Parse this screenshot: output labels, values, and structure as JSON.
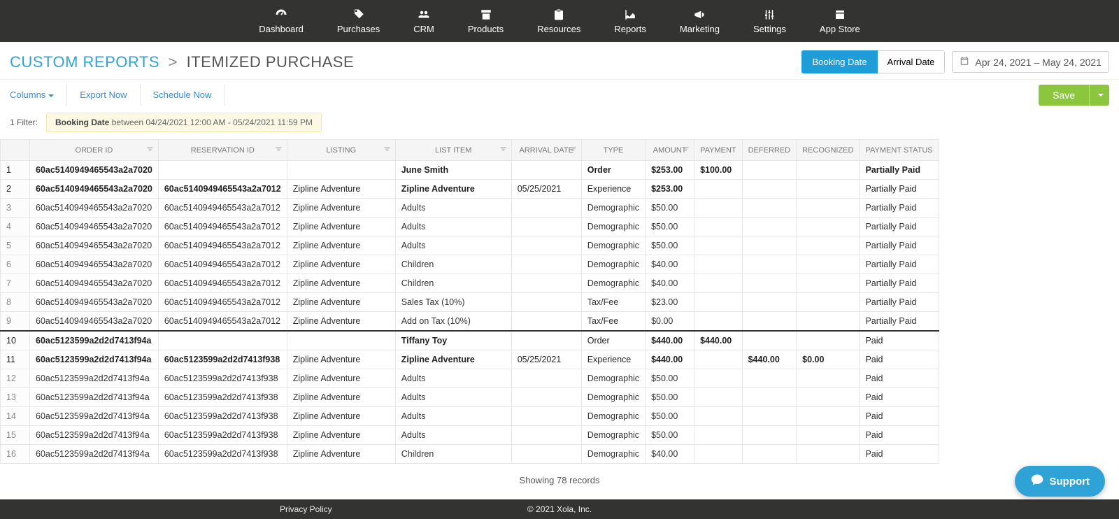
{
  "nav": {
    "items": [
      {
        "label": "Dashboard",
        "icon": "dashboard"
      },
      {
        "label": "Purchases",
        "icon": "tag"
      },
      {
        "label": "CRM",
        "icon": "people"
      },
      {
        "label": "Products",
        "icon": "box"
      },
      {
        "label": "Resources",
        "icon": "clipboard"
      },
      {
        "label": "Reports",
        "icon": "chart"
      },
      {
        "label": "Marketing",
        "icon": "megaphone"
      },
      {
        "label": "Settings",
        "icon": "sliders"
      },
      {
        "label": "App Store",
        "icon": "app"
      }
    ]
  },
  "breadcrumb": {
    "root": "CUSTOM REPORTS",
    "sep": ">",
    "page": "ITEMIZED PURCHASE"
  },
  "dateToggle": {
    "booking": "Booking Date",
    "arrival": "Arrival Date",
    "active": "booking"
  },
  "dateRange": "Apr 24, 2021 – May 24, 2021",
  "toolbar": {
    "columns": "Columns",
    "export": "Export Now",
    "schedule": "Schedule Now",
    "save": "Save"
  },
  "filter": {
    "count_label": "1 Filter:",
    "field": "Booking Date",
    "text": "between 04/24/2021 12:00 AM - 05/24/2021 11:59 PM"
  },
  "columns": [
    "ORDER ID",
    "RESERVATION ID",
    "LISTING",
    "LIST ITEM",
    "ARRIVAL DATE",
    "TYPE",
    "AMOUNT",
    "PAYMENT",
    "DEFERRED",
    "RECOGNIZED",
    "PAYMENT STATUS"
  ],
  "filterable_cols": [
    0,
    1,
    2,
    3,
    4,
    6
  ],
  "rows": [
    {
      "n": 1,
      "bold": true,
      "cells": [
        "60ac5140949465543a2a7020",
        "",
        "",
        "June Smith",
        "",
        "Order",
        "$253.00",
        "$100.00",
        "",
        "",
        "Partially Paid"
      ]
    },
    {
      "n": 2,
      "bold": true,
      "cells": [
        "60ac5140949465543a2a7020",
        "60ac5140949465543a2a7012",
        "Zipline Adventure",
        "Zipline Adventure",
        "05/25/2021",
        "Experience",
        "$253.00",
        "",
        "",
        "",
        "Partially Paid"
      ],
      "light_cols": [
        2,
        4,
        5,
        10
      ]
    },
    {
      "n": 3,
      "bold": false,
      "cells": [
        "60ac5140949465543a2a7020",
        "60ac5140949465543a2a7012",
        "Zipline Adventure",
        "Adults",
        "",
        "Demographic",
        "$50.00",
        "",
        "",
        "",
        "Partially Paid"
      ]
    },
    {
      "n": 4,
      "bold": false,
      "cells": [
        "60ac5140949465543a2a7020",
        "60ac5140949465543a2a7012",
        "Zipline Adventure",
        "Adults",
        "",
        "Demographic",
        "$50.00",
        "",
        "",
        "",
        "Partially Paid"
      ]
    },
    {
      "n": 5,
      "bold": false,
      "cells": [
        "60ac5140949465543a2a7020",
        "60ac5140949465543a2a7012",
        "Zipline Adventure",
        "Adults",
        "",
        "Demographic",
        "$50.00",
        "",
        "",
        "",
        "Partially Paid"
      ]
    },
    {
      "n": 6,
      "bold": false,
      "cells": [
        "60ac5140949465543a2a7020",
        "60ac5140949465543a2a7012",
        "Zipline Adventure",
        "Children",
        "",
        "Demographic",
        "$40.00",
        "",
        "",
        "",
        "Partially Paid"
      ]
    },
    {
      "n": 7,
      "bold": false,
      "cells": [
        "60ac5140949465543a2a7020",
        "60ac5140949465543a2a7012",
        "Zipline Adventure",
        "Children",
        "",
        "Demographic",
        "$40.00",
        "",
        "",
        "",
        "Partially Paid"
      ]
    },
    {
      "n": 8,
      "bold": false,
      "cells": [
        "60ac5140949465543a2a7020",
        "60ac5140949465543a2a7012",
        "Zipline Adventure",
        "Sales Tax (10%)",
        "",
        "Tax/Fee",
        "$23.00",
        "",
        "",
        "",
        "Partially Paid"
      ]
    },
    {
      "n": 9,
      "bold": false,
      "cells": [
        "60ac5140949465543a2a7020",
        "60ac5140949465543a2a7012",
        "Zipline Adventure",
        "Add on Tax (10%)",
        "",
        "Tax/Fee",
        "$0.00",
        "",
        "",
        "",
        "Partially Paid"
      ]
    },
    {
      "n": 10,
      "bold": true,
      "dark": true,
      "cells": [
        "60ac5123599a2d2d7413f94a",
        "",
        "",
        "Tiffany Toy",
        "",
        "Order",
        "$440.00",
        "$440.00",
        "",
        "",
        "Paid"
      ],
      "light_cols": [
        5,
        10
      ]
    },
    {
      "n": 11,
      "bold": true,
      "cells": [
        "60ac5123599a2d2d7413f94a",
        "60ac5123599a2d2d7413f938",
        "Zipline Adventure",
        "Zipline Adventure",
        "05/25/2021",
        "Experience",
        "$440.00",
        "",
        "$440.00",
        "$0.00",
        "Paid"
      ],
      "light_cols": [
        2,
        4,
        5,
        10
      ]
    },
    {
      "n": 12,
      "bold": false,
      "cells": [
        "60ac5123599a2d2d7413f94a",
        "60ac5123599a2d2d7413f938",
        "Zipline Adventure",
        "Adults",
        "",
        "Demographic",
        "$50.00",
        "",
        "",
        "",
        "Paid"
      ]
    },
    {
      "n": 13,
      "bold": false,
      "cells": [
        "60ac5123599a2d2d7413f94a",
        "60ac5123599a2d2d7413f938",
        "Zipline Adventure",
        "Adults",
        "",
        "Demographic",
        "$50.00",
        "",
        "",
        "",
        "Paid"
      ]
    },
    {
      "n": 14,
      "bold": false,
      "cells": [
        "60ac5123599a2d2d7413f94a",
        "60ac5123599a2d2d7413f938",
        "Zipline Adventure",
        "Adults",
        "",
        "Demographic",
        "$50.00",
        "",
        "",
        "",
        "Paid"
      ]
    },
    {
      "n": 15,
      "bold": false,
      "cells": [
        "60ac5123599a2d2d7413f94a",
        "60ac5123599a2d2d7413f938",
        "Zipline Adventure",
        "Adults",
        "",
        "Demographic",
        "$50.00",
        "",
        "",
        "",
        "Paid"
      ]
    },
    {
      "n": 16,
      "bold": false,
      "cells": [
        "60ac5123599a2d2d7413f94a",
        "60ac5123599a2d2d7413f938",
        "Zipline Adventure",
        "Children",
        "",
        "Demographic",
        "$40.00",
        "",
        "",
        "",
        "Paid"
      ]
    }
  ],
  "totals": "Showing 78 records",
  "footer": {
    "privacy": "Privacy Policy",
    "copyright": "© 2021 Xola, Inc."
  },
  "support": "Support"
}
